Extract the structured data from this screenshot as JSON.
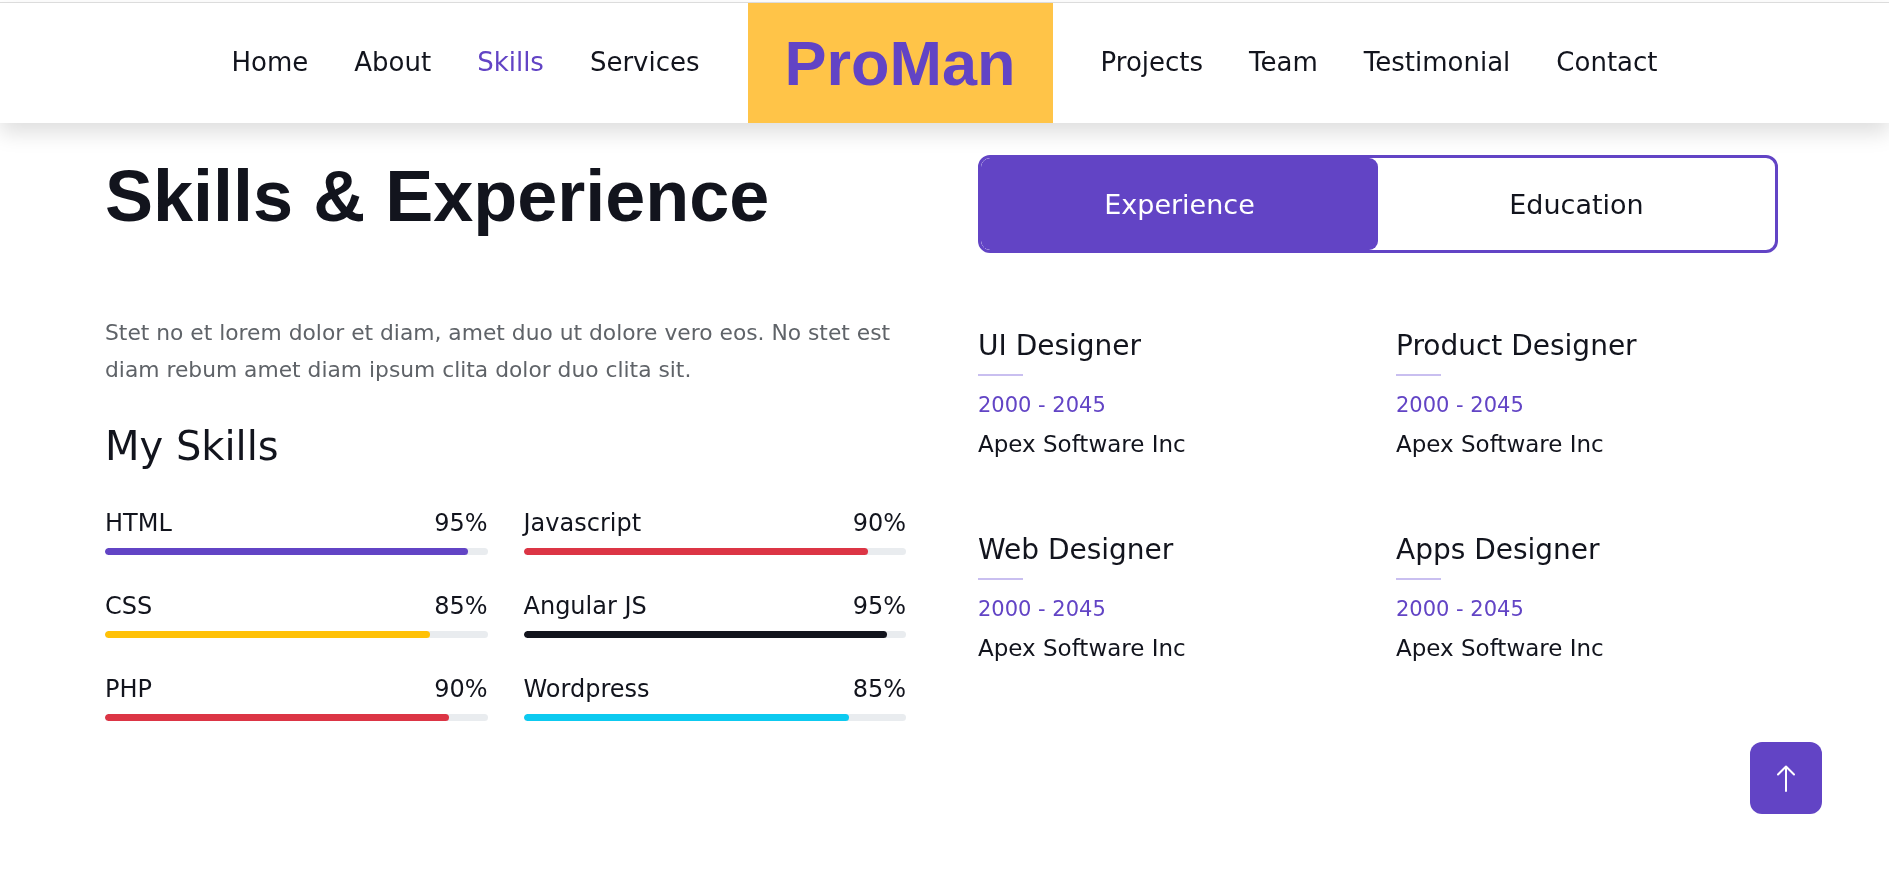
{
  "navbar": {
    "left_links": [
      {
        "label": "Home",
        "selected": false
      },
      {
        "label": "About",
        "selected": false
      },
      {
        "label": "Skills",
        "selected": true
      },
      {
        "label": "Services",
        "selected": false
      }
    ],
    "logo": "ProMan",
    "right_links": [
      {
        "label": "Projects",
        "selected": false
      },
      {
        "label": "Team",
        "selected": false
      },
      {
        "label": "Testimonial",
        "selected": false
      },
      {
        "label": "Contact",
        "selected": false
      }
    ]
  },
  "intro": {
    "title": "Skills & Experience",
    "description": "Stet no et lorem dolor et diam, amet duo ut dolore vero eos. No stet est diam rebum amet diam ipsum clita dolor duo clita sit.",
    "skills_heading": "My Skills"
  },
  "skills": [
    {
      "name": "HTML",
      "reading": "95%",
      "level": 0.95,
      "color": "#6244c5"
    },
    {
      "name": "Javascript",
      "reading": "90%",
      "level": 0.9,
      "color": "#dc3545"
    },
    {
      "name": "CSS",
      "reading": "85%",
      "level": 0.85,
      "color": "#ffc107"
    },
    {
      "name": "Angular JS",
      "reading": "95%",
      "level": 0.95,
      "color": "#12141d"
    },
    {
      "name": "PHP",
      "reading": "90%",
      "level": 0.9,
      "color": "#dc3545"
    },
    {
      "name": "Wordpress",
      "reading": "85%",
      "level": 0.85,
      "color": "#0dcaf0"
    }
  ],
  "tabs": [
    {
      "label": "Experience",
      "selected": true
    },
    {
      "label": "Education",
      "selected": false
    }
  ],
  "experience": [
    {
      "title": "UI Designer",
      "period": "2000 - 2045",
      "company": "Apex Software Inc"
    },
    {
      "title": "Product Designer",
      "period": "2000 - 2045",
      "company": "Apex Software Inc"
    },
    {
      "title": "Web Designer",
      "period": "2000 - 2045",
      "company": "Apex Software Inc"
    },
    {
      "title": "Apps Designer",
      "period": "2000 - 2045",
      "company": "Apex Software Inc"
    }
  ]
}
